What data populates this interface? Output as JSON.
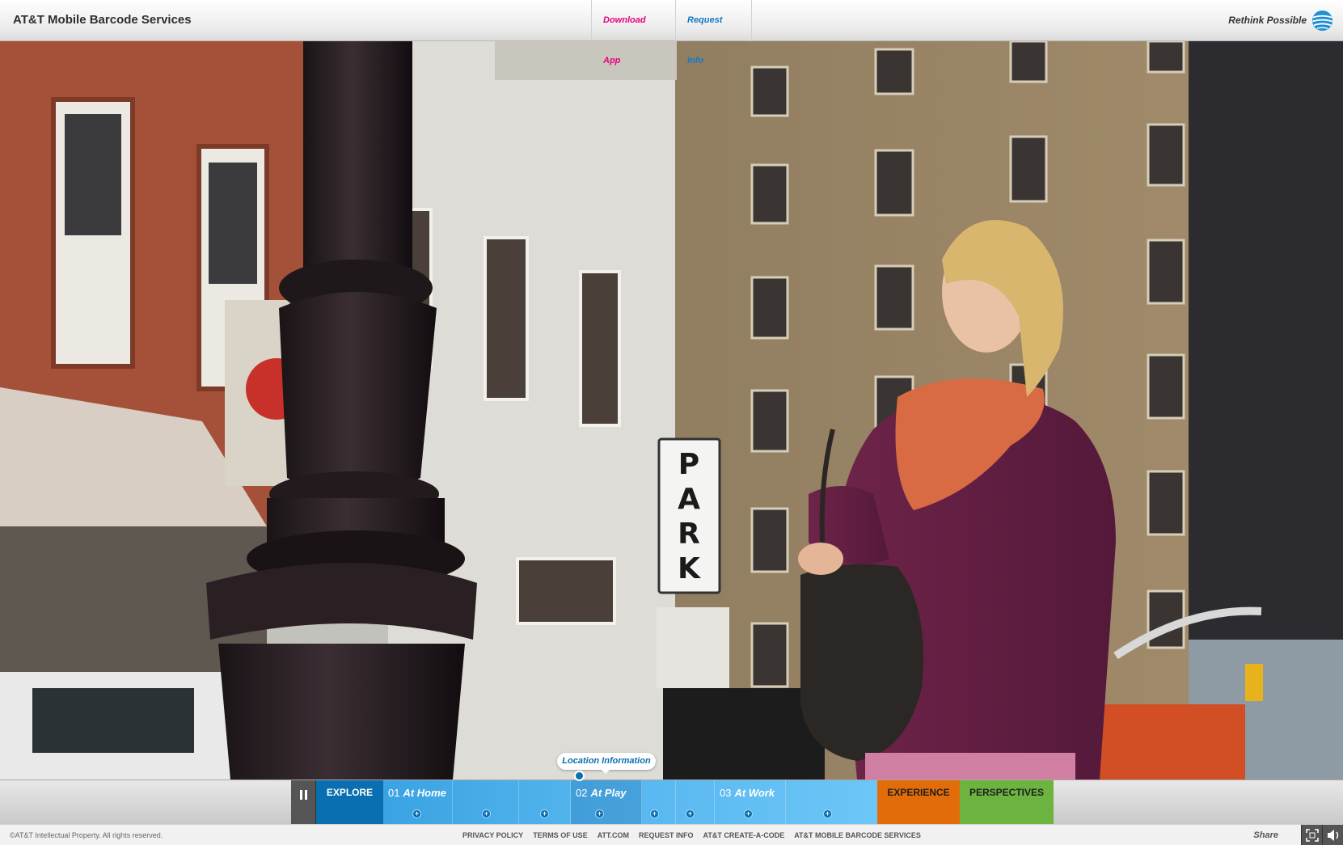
{
  "header": {
    "brand": "AT&T Mobile Barcode Services",
    "nav": {
      "download_app": "Download App",
      "request_info": "Request Info"
    },
    "tagline": "Rethink Possible",
    "logo_icon": "att-globe-icon"
  },
  "scene": {
    "sign_letters": [
      "P",
      "A",
      "R",
      "K"
    ]
  },
  "timeline": {
    "pause_icon": "pause-icon",
    "explore": "EXPLORE",
    "segments": [
      {
        "number": "01",
        "title": "At Home"
      },
      {
        "number": "02",
        "title": "At Play"
      },
      {
        "number": "03",
        "title": "At Work"
      }
    ],
    "dot_glyph": "+",
    "tooltip": "Location Information",
    "experience": "EXPERIENCE",
    "perspectives": "PERSPECTIVES"
  },
  "footer": {
    "copyright": "©AT&T Intellectual Property. All rights reserved.",
    "links": [
      "PRIVACY POLICY",
      "TERMS OF USE",
      "ATT.COM",
      "REQUEST INFO",
      "AT&T CREATE-A-CODE",
      "AT&T MOBILE BARCODE SERVICES"
    ],
    "share": "Share",
    "fullscreen_icon": "fullscreen-icon",
    "sound_icon": "speaker-icon"
  },
  "colors": {
    "download_pink": "#e6007e",
    "request_blue": "#1479c4",
    "explore_blue": "#0a6fb0",
    "experience_orange": "#e36c0a",
    "perspectives_green": "#6cb33f"
  }
}
